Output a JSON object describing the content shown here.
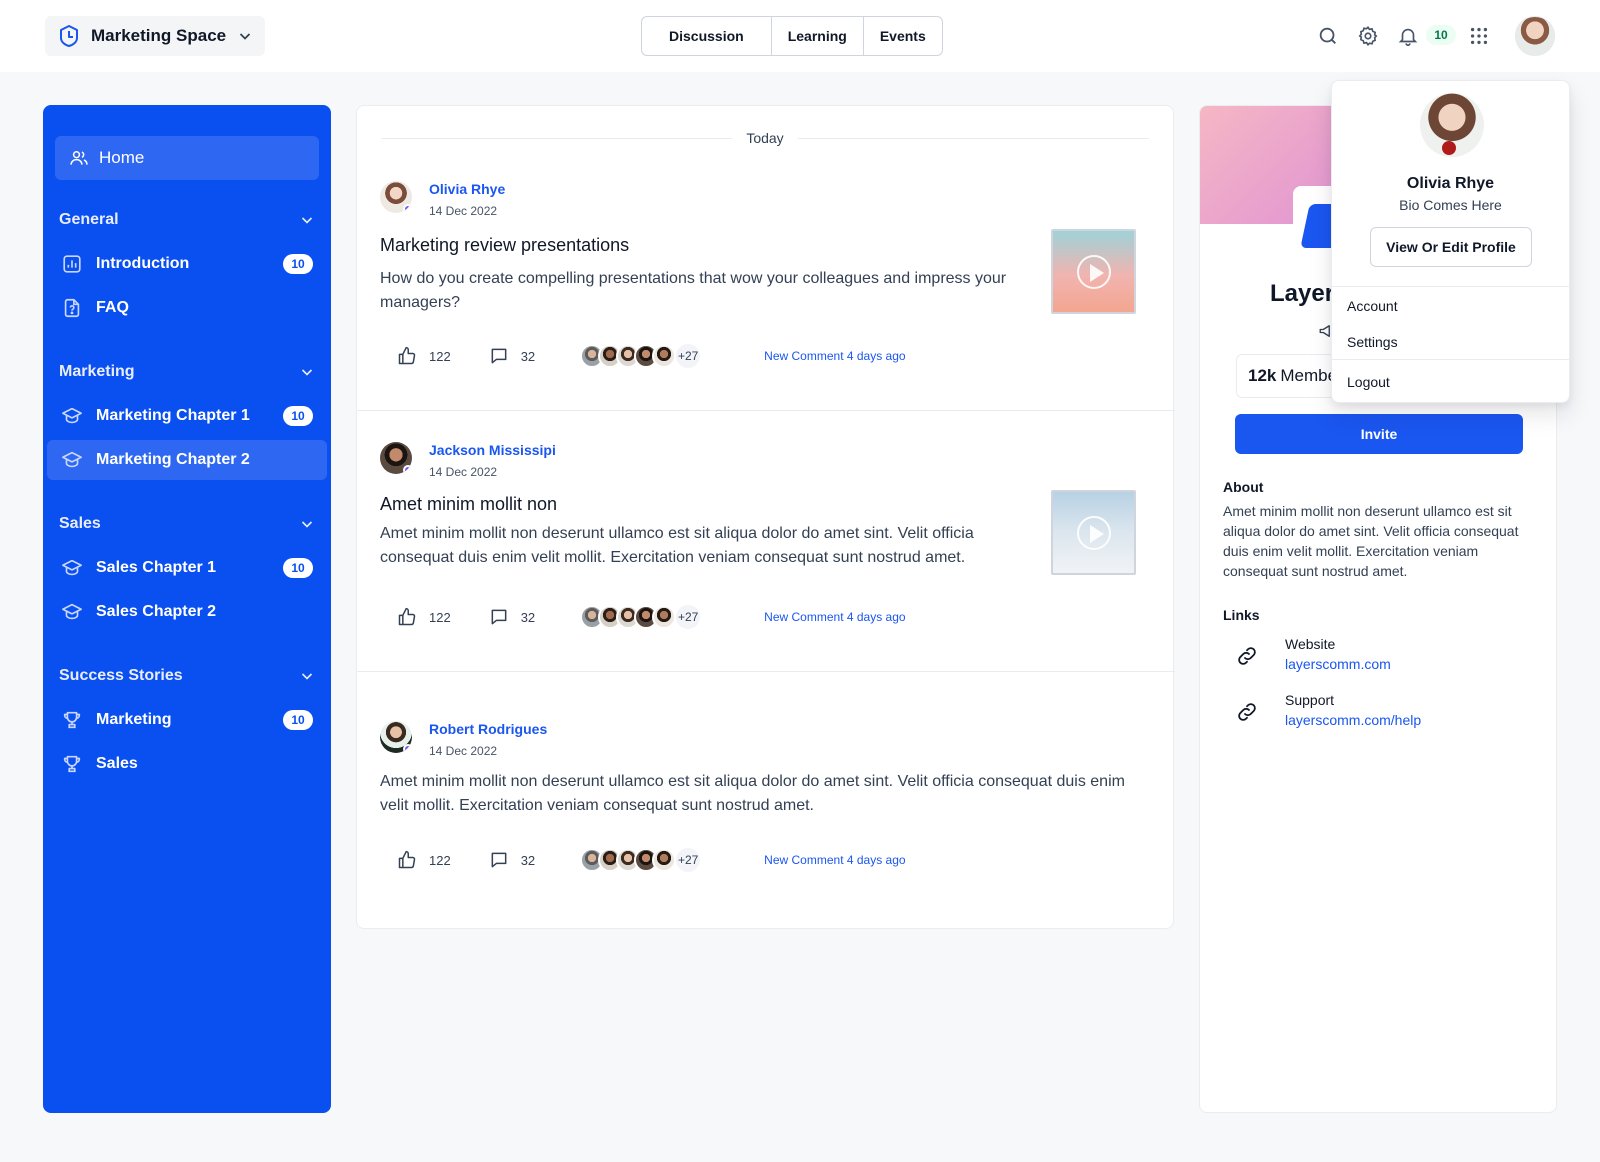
{
  "header": {
    "space_name": "Marketing Space",
    "tabs": [
      {
        "label": "Discussion"
      },
      {
        "label": "Learning"
      },
      {
        "label": "Events"
      }
    ],
    "notification_count": "10",
    "icons": [
      "search-icon",
      "gear-icon",
      "bell-icon",
      "apps-grid-icon"
    ]
  },
  "sidebar": {
    "home_label": "Home",
    "sections": [
      {
        "title": "General",
        "items": [
          {
            "label": "Introduction",
            "badge": "10",
            "icon": "chart-icon"
          },
          {
            "label": "FAQ",
            "badge": "",
            "icon": "document-question-icon"
          }
        ]
      },
      {
        "title": "Marketing",
        "items": [
          {
            "label": "Marketing Chapter 1",
            "badge": "10",
            "icon": "graduation-cap-icon"
          },
          {
            "label": "Marketing Chapter 2",
            "badge": "",
            "icon": "graduation-cap-icon",
            "active": true
          }
        ]
      },
      {
        "title": "Sales",
        "items": [
          {
            "label": "Sales Chapter 1",
            "badge": "10",
            "icon": "graduation-cap-icon"
          },
          {
            "label": "Sales Chapter 2",
            "badge": "",
            "icon": "graduation-cap-icon"
          }
        ]
      },
      {
        "title": "Success Stories",
        "items": [
          {
            "label": "Marketing",
            "badge": "10",
            "icon": "trophy-icon"
          },
          {
            "label": "Sales",
            "badge": "",
            "icon": "trophy-icon"
          }
        ]
      }
    ]
  },
  "feed": {
    "divider_label": "Today",
    "posts": [
      {
        "author": "Olivia Rhye",
        "date": "14 Dec 2022",
        "title": "Marketing review presentations",
        "body": "How do you create compelling presentations that wow your colleagues and impress your managers?",
        "likes": "122",
        "comments": "32",
        "more_participants": "+27",
        "new_comment": "New Comment 4 days ago"
      },
      {
        "author": "Jackson Mississipi",
        "date": "14 Dec 2022",
        "title": "Amet minim mollit non",
        "body": "Amet minim mollit non deserunt ullamco est sit aliqua dolor do amet sint. Velit officia consequat duis enim velit mollit. Exercitation veniam consequat sunt nostrud amet.",
        "likes": "122",
        "comments": "32",
        "more_participants": "+27",
        "new_comment": "New Comment 4 days ago"
      },
      {
        "author": "Robert Rodrigues",
        "date": "14 Dec 2022",
        "title": "",
        "body": "Amet minim mollit non deserunt ullamco est sit aliqua dolor do amet sint. Velit officia consequat duis enim velit mollit. Exercitation veniam consequat sunt nostrud amet.",
        "likes": "122",
        "comments": "32",
        "more_participants": "+27",
        "new_comment": "New Comment 4 days ago"
      }
    ]
  },
  "community": {
    "name_visible": "Layer",
    "members_count": "12k",
    "members_label": "Membe",
    "invite_label": "Invite",
    "about_heading": "About",
    "about_text": "Amet minim mollit non deserunt ullamco est sit aliqua dolor do amet sint. Velit officia consequat duis enim velit mollit. Exercitation veniam consequat sunt nostrud amet.",
    "links_heading": "Links",
    "links": [
      {
        "title": "Website",
        "url": "layerscomm.com"
      },
      {
        "title": "Support",
        "url": "layerscomm.com/help"
      }
    ]
  },
  "profile_menu": {
    "name": "Olivia Rhye",
    "bio": "Bio Comes Here",
    "edit_button": "View Or Edit Profile",
    "items": [
      "Account",
      "Settings",
      "Logout"
    ]
  },
  "colors": {
    "primary": "#1a56f0",
    "sidebar_bg": "#0a4ff0",
    "notification_badge_bg": "#ecfdf3",
    "notification_badge_text": "#027a48"
  }
}
